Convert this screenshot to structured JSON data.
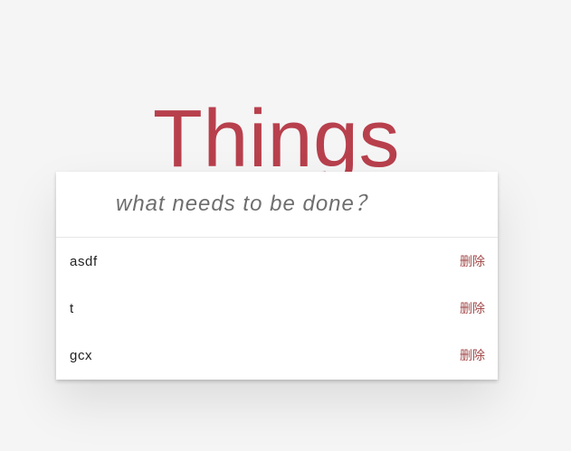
{
  "header": {
    "title": "Things"
  },
  "new_todo": {
    "placeholder": "what needs to be done？",
    "value": ""
  },
  "todos": [
    {
      "text": "asdf",
      "delete_label": "删除"
    },
    {
      "text": "t",
      "delete_label": "删除"
    },
    {
      "text": "gcx",
      "delete_label": "删除"
    }
  ],
  "colors": {
    "title": "#b8404d",
    "delete": "#a34a4a",
    "background": "#f5f5f5"
  }
}
